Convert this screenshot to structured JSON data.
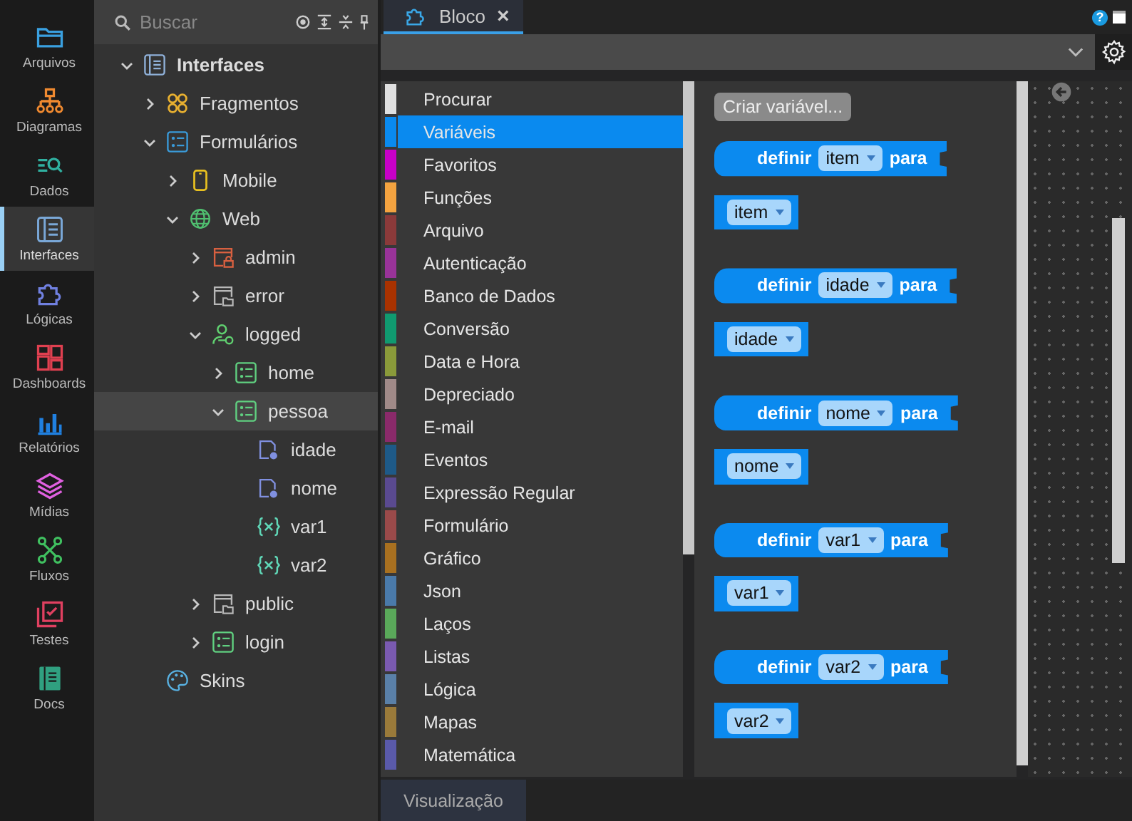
{
  "rail": [
    {
      "label": "Arquivos",
      "color": "#3aa0e0",
      "selected": false
    },
    {
      "label": "Diagramas",
      "color": "#f08a30",
      "selected": false
    },
    {
      "label": "Dados",
      "color": "#30b0a0",
      "selected": false
    },
    {
      "label": "Interfaces",
      "color": "#7aa8d8",
      "selected": true
    },
    {
      "label": "Lógicas",
      "color": "#7080e0",
      "selected": false
    },
    {
      "label": "Dashboards",
      "color": "#e04050",
      "selected": false
    },
    {
      "label": "Relatórios",
      "color": "#2080e0",
      "selected": false
    },
    {
      "label": "Mídias",
      "color": "#e060e0",
      "selected": false
    },
    {
      "label": "Fluxos",
      "color": "#40c060",
      "selected": false
    },
    {
      "label": "Testes",
      "color": "#e04060",
      "selected": false
    },
    {
      "label": "Docs",
      "color": "#30a080",
      "selected": false
    }
  ],
  "search": {
    "placeholder": "Buscar"
  },
  "tree": [
    {
      "label": "Interfaces",
      "kind": "interfaces",
      "expanded": true,
      "selected": false,
      "children": [
        {
          "label": "Fragmentos",
          "kind": "fragments",
          "expanded": false,
          "selected": false
        },
        {
          "label": "Formulários",
          "kind": "forms",
          "expanded": true,
          "selected": false,
          "children": [
            {
              "label": "Mobile",
              "kind": "mobile",
              "expanded": false,
              "selected": false
            },
            {
              "label": "Web",
              "kind": "web",
              "expanded": true,
              "selected": false,
              "children": [
                {
                  "label": "admin",
                  "kind": "admin",
                  "expanded": false,
                  "selected": false
                },
                {
                  "label": "error",
                  "kind": "page",
                  "expanded": false,
                  "selected": false
                },
                {
                  "label": "logged",
                  "kind": "user",
                  "expanded": true,
                  "selected": false,
                  "children": [
                    {
                      "label": "home",
                      "kind": "form",
                      "expanded": false,
                      "selected": false
                    },
                    {
                      "label": "pessoa",
                      "kind": "form",
                      "expanded": true,
                      "selected": true,
                      "children": [
                        {
                          "label": "idade",
                          "kind": "field",
                          "selected": false
                        },
                        {
                          "label": "nome",
                          "kind": "field",
                          "selected": false
                        },
                        {
                          "label": "var1",
                          "kind": "variable",
                          "selected": false
                        },
                        {
                          "label": "var2",
                          "kind": "variable",
                          "selected": false
                        }
                      ]
                    }
                  ]
                },
                {
                  "label": "public",
                  "kind": "page",
                  "expanded": false,
                  "selected": false
                },
                {
                  "label": "login",
                  "kind": "form",
                  "expanded": false,
                  "selected": false
                }
              ]
            }
          ]
        },
        {
          "label": "Skins",
          "kind": "skins",
          "selected": false
        }
      ]
    }
  ],
  "tabs": [
    {
      "label": "Bloco",
      "close": "×",
      "selected": true
    }
  ],
  "help": "?",
  "categories": [
    {
      "label": "Procurar",
      "color": "#e0e0e0",
      "selected": false
    },
    {
      "label": "Variáveis",
      "color": "#0a8aef",
      "selected": true
    },
    {
      "label": "Favoritos",
      "color": "#c800c8",
      "selected": false
    },
    {
      "label": "Funções",
      "color": "#f4a340",
      "selected": false
    },
    {
      "label": "Arquivo",
      "color": "#8b3a3a",
      "selected": false
    },
    {
      "label": "Autenticação",
      "color": "#993399",
      "selected": false
    },
    {
      "label": "Banco de Dados",
      "color": "#a83200",
      "selected": false
    },
    {
      "label": "Conversão",
      "color": "#109a70",
      "selected": false
    },
    {
      "label": "Data e Hora",
      "color": "#8a9a3a",
      "selected": false
    },
    {
      "label": "Depreciado",
      "color": "#a08a88",
      "selected": false
    },
    {
      "label": "E-mail",
      "color": "#8a2a6a",
      "selected": false
    },
    {
      "label": "Eventos",
      "color": "#1e5a88",
      "selected": false
    },
    {
      "label": "Expressão Regular",
      "color": "#5a4a90",
      "selected": false
    },
    {
      "label": "Formulário",
      "color": "#9a4a4a",
      "selected": false
    },
    {
      "label": "Gráfico",
      "color": "#a87020",
      "selected": false
    },
    {
      "label": "Json",
      "color": "#4a7aaa",
      "selected": false
    },
    {
      "label": "Laços",
      "color": "#5aa85a",
      "selected": false
    },
    {
      "label": "Listas",
      "color": "#7a5ab0",
      "selected": false
    },
    {
      "label": "Lógica",
      "color": "#5a80a8",
      "selected": false
    },
    {
      "label": "Mapas",
      "color": "#9a7a3a",
      "selected": false
    },
    {
      "label": "Matemática",
      "color": "#5a5aaa",
      "selected": false
    }
  ],
  "flyout": {
    "button": "Criar variável...",
    "blocks": [
      {
        "kind": "setter",
        "prefix": "definir",
        "variable": "item",
        "suffix": "para"
      },
      {
        "kind": "getter",
        "variable": "item"
      },
      {
        "kind": "setter",
        "prefix": "definir",
        "variable": "idade",
        "suffix": "para"
      },
      {
        "kind": "getter",
        "variable": "idade"
      },
      {
        "kind": "setter",
        "prefix": "definir",
        "variable": "nome",
        "suffix": "para"
      },
      {
        "kind": "getter",
        "variable": "nome"
      },
      {
        "kind": "setter",
        "prefix": "definir",
        "variable": "var1",
        "suffix": "para"
      },
      {
        "kind": "getter",
        "variable": "var1"
      },
      {
        "kind": "setter",
        "prefix": "definir",
        "variable": "var2",
        "suffix": "para"
      },
      {
        "kind": "getter",
        "variable": "var2"
      }
    ]
  },
  "bottom_tabs": [
    {
      "label": "Visualização",
      "selected": true
    }
  ]
}
